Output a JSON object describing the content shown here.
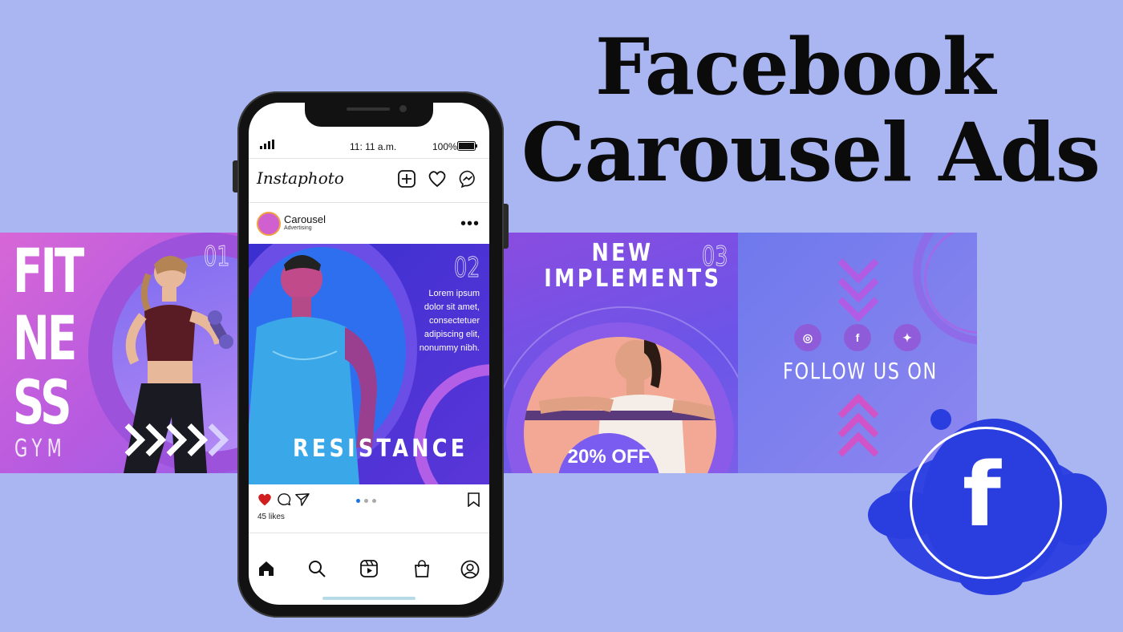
{
  "headline": {
    "line1": "Facebook",
    "line2": "Carousel Ads"
  },
  "slides": {
    "slide1": {
      "title_lines": [
        "FIT",
        "NE",
        "SS"
      ],
      "subtitle": "GYM",
      "number": "01"
    },
    "slide2": {
      "number": "02",
      "lorem_lines": [
        "Lorem ipsum",
        "dolor sit amet,",
        "consectetuer",
        "adipiscing elit,",
        "nonummy nibh."
      ],
      "headline": "RESISTANCE"
    },
    "slide3": {
      "number": "03",
      "headline_lines": [
        "NEW",
        "IMPLEMENTS"
      ],
      "badge": "20% OFF"
    },
    "slide4": {
      "cta": "FOLLOW US ON",
      "social_icons": [
        "instagram-icon",
        "facebook-icon",
        "twitter-icon"
      ]
    }
  },
  "phone": {
    "status": {
      "time": "11: 11 a.m.",
      "battery": "100%"
    },
    "app_name": "Instaphoto",
    "post": {
      "account": "Carousel",
      "account_sub": "Advertising",
      "likes": "45 likes"
    },
    "carousel_dots": 3,
    "active_dot": 0
  },
  "colors": {
    "background": "#aab6f2",
    "accent_blue": "#2a3ee0",
    "like_red": "#d11f1f",
    "active_dot": "#1a73e8"
  }
}
